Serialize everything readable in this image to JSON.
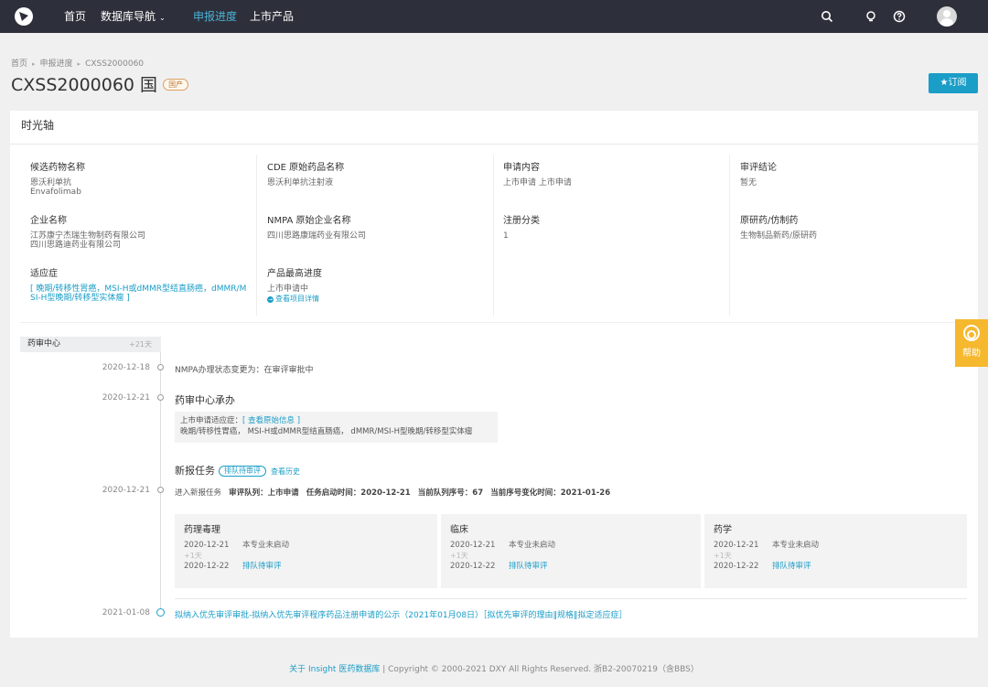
{
  "nav": {
    "items": [
      "首页",
      "数据库导航",
      "申报进度",
      "上市产品"
    ],
    "chevron": "⌄"
  },
  "breadcrumb": [
    "首页",
    "申报进度",
    "CXSS2000060"
  ],
  "breadcrumb_sep": "▸",
  "title": "CXSS2000060 国",
  "badge": "国产",
  "subscribe": "★订阅",
  "panel_title": "时光轴",
  "info": {
    "drug_name": {
      "label": "候选药物名称",
      "values": [
        "恩沃利单抗",
        "Envafolimab"
      ]
    },
    "cde_name": {
      "label": "CDE 原始药品名称",
      "values": [
        "恩沃利单抗注射液"
      ]
    },
    "apply_content": {
      "label": "申请内容",
      "values": [
        "上市申请 上市申请"
      ]
    },
    "conclusion": {
      "label": "审评结论",
      "values": [
        "暂无"
      ]
    },
    "company": {
      "label": "企业名称",
      "values": [
        "江苏康宁杰瑞生物制药有限公司",
        "四川思路迪药业有限公司"
      ]
    },
    "nmpa_company": {
      "label": "NMPA 原始企业名称",
      "values": [
        "四川思路康瑞药业有限公司"
      ]
    },
    "reg_class": {
      "label": "注册分类",
      "values": [
        "1"
      ]
    },
    "origin": {
      "label": "原研药/仿制药",
      "values": [
        "生物制品新药/原研药"
      ]
    },
    "indication": {
      "label": "适应症",
      "values": [
        "[ 晚期/转移性胃癌，MSI-H或dMMR型结直肠癌，dMMR/M",
        "SI-H型晚期/转移型实体瘤 ]"
      ]
    },
    "progress": {
      "label": "产品最高进度",
      "values": [
        "上市申请中"
      ],
      "detail": "查看项目详情",
      "detail_icon": "→"
    }
  },
  "timeline": {
    "tab": "药审中心",
    "tab_days": "+21天",
    "events": {
      "e1": {
        "date": "2020-12-18",
        "text": "NMPA办理状态变更为：在审评审批中"
      },
      "e2": {
        "date": "2020-12-21",
        "head": "药审中心承办",
        "box_prefix": "上市申请适应症：",
        "box_link": "[ 查看原始信息 ]",
        "box_text": "晚期/转移性胃癌， MSI-H或dMMR型结直肠癌， dMMR/MSI-H型晚期/转移型实体瘤"
      },
      "e3": {
        "date": "2020-12-21",
        "head": "新报任务",
        "pill": "排队待审评",
        "history": "查看历史",
        "prefix": "进入新报任务",
        "queue_label": "审评队列：",
        "queue": "上市申请",
        "start_label": "任务启动时间：",
        "start": "2020-12-21",
        "pos_label": "当前队列序号：",
        "pos": "67",
        "change_label": "当前序号变化时间：",
        "change": "2021-01-26"
      },
      "e4": {
        "date": "2021-01-08",
        "text": "拟纳入优先审评审批-拟纳入优先审评程序药品注册申请的公示（2021年01月08日）［拟优先审评的理由‖规格‖拟定适应症］"
      }
    },
    "specs": [
      {
        "title": "药理毒理",
        "d1": "2020-12-21",
        "s1": "本专业未启动",
        "plus": "+1天",
        "d2": "2020-12-22",
        "s2": "排队待审评"
      },
      {
        "title": "临床",
        "d1": "2020-12-21",
        "s1": "本专业未启动",
        "plus": "+1天",
        "d2": "2020-12-22",
        "s2": "排队待审评"
      },
      {
        "title": "药学",
        "d1": "2020-12-21",
        "s1": "本专业未启动",
        "plus": "+1天",
        "d2": "2020-12-22",
        "s2": "排队待审评"
      }
    ]
  },
  "help": "帮助",
  "footer": {
    "link": "关于 Insight 医药数据库",
    "text": " | Copyright © 2000-2021 DXY All Rights Reserved. 浙B2-20070219（含BBS）"
  },
  "colors": {
    "nav_bg": "#2d2f3a",
    "accent": "#1a9dc7",
    "help": "#f5b82e"
  },
  "icons": {
    "search": "search-icon",
    "lightbulb": "lightbulb-icon",
    "help": "help-icon",
    "avatar": "avatar-icon"
  }
}
